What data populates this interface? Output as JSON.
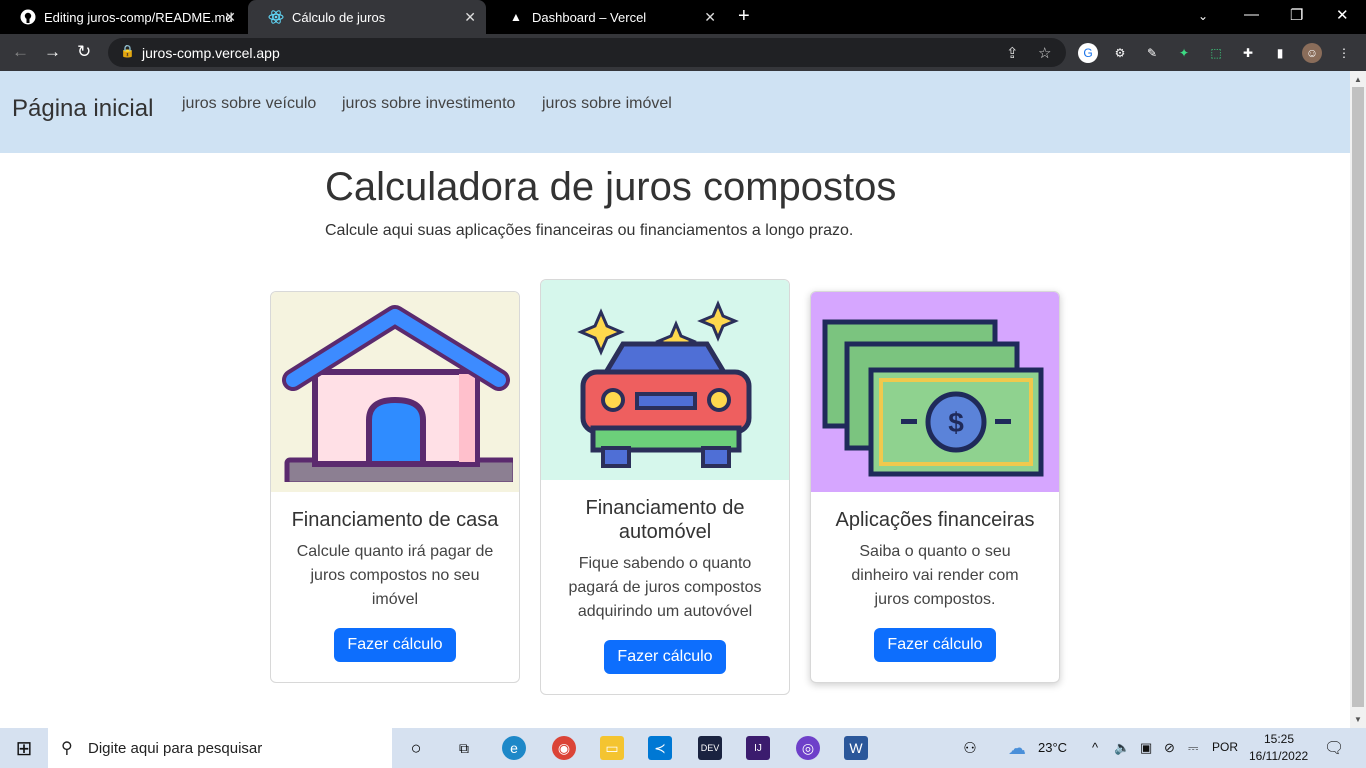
{
  "browser": {
    "tabs": [
      {
        "title": "Editing juros-comp/README.md",
        "icon": "github-icon"
      },
      {
        "title": "Cálculo de juros",
        "icon": "react-icon"
      },
      {
        "title": "Dashboard – Vercel",
        "icon": "vercel-icon"
      }
    ],
    "url": "juros-comp.vercel.app"
  },
  "nav": {
    "brand": "Página inicial",
    "links": [
      "juros sobre veículo",
      "juros sobre investimento",
      "juros sobre imóvel"
    ]
  },
  "hero": {
    "title": "Calculadora de juros compostos",
    "subtitle": "Calcule aqui suas aplicações financeiras ou financiamentos a longo prazo."
  },
  "cards": [
    {
      "title": "Financiamento de casa",
      "text": "Calcule quanto irá pagar de juros compostos no seu imóvel",
      "button": "Fazer cálculo",
      "bg": "#f5f3df",
      "icon": "house-icon"
    },
    {
      "title": "Financiamento de automóvel",
      "text": "Fique sabendo o quanto pagará de juros compostos adquirindo um autovóvel",
      "button": "Fazer cálculo",
      "bg": "#d6f7ec",
      "icon": "car-icon"
    },
    {
      "title": "Aplicações financeiras",
      "text": "Saiba o quanto o seu dinheiro vai render com juros compostos.",
      "button": "Fazer cálculo",
      "bg": "#d6a6ff",
      "icon": "money-icon"
    }
  ],
  "taskbar": {
    "search_placeholder": "Digite aqui para pesquisar",
    "weather": "23°C",
    "lang": "POR",
    "time": "15:25",
    "date": "16/11/2022"
  }
}
